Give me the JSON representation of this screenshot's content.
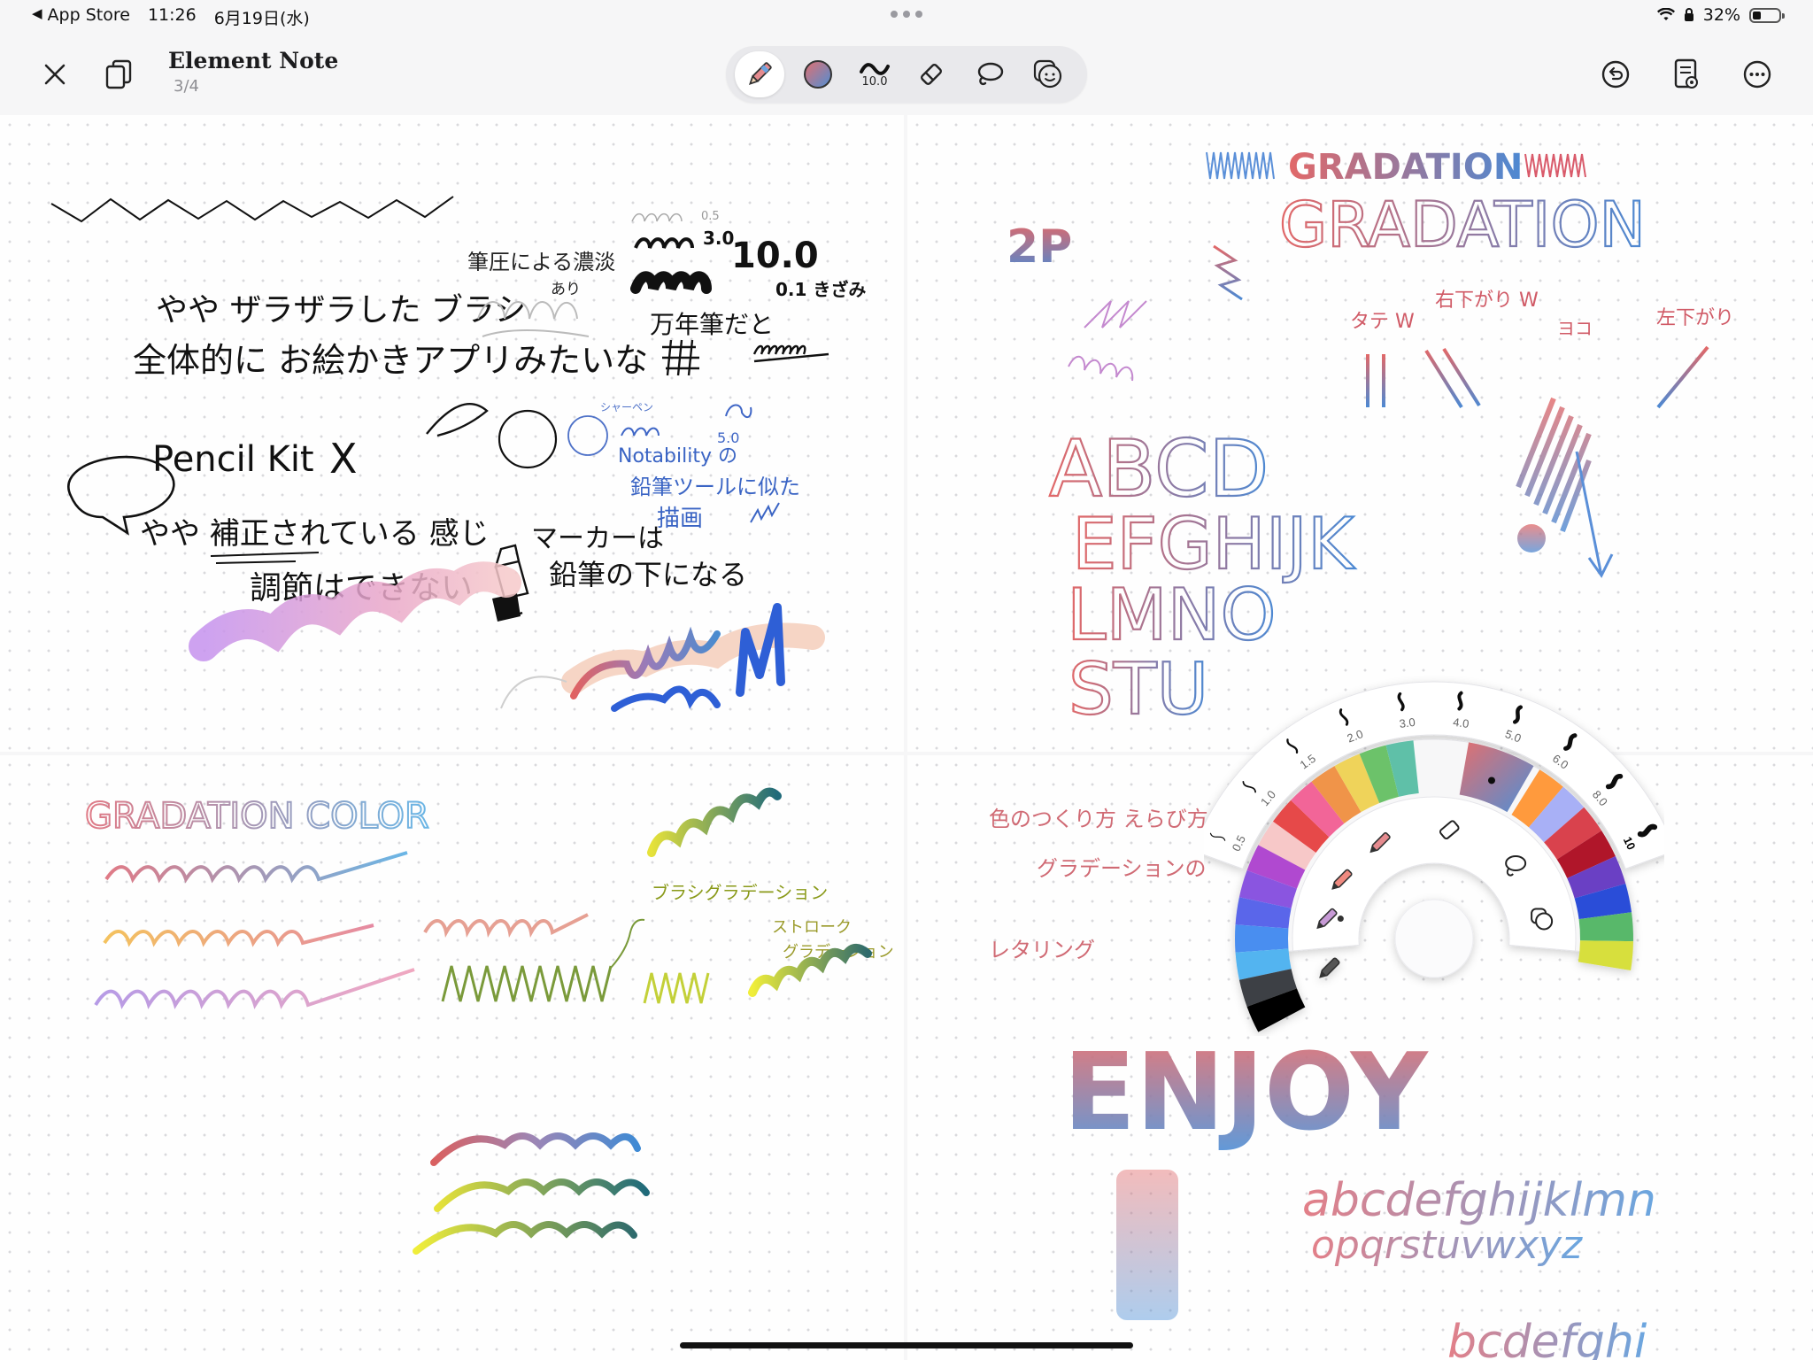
{
  "status_bar": {
    "back_app": "App Store",
    "time": "11:26",
    "date": "6月19日(水)",
    "battery": "32%",
    "battery_level": 0.32
  },
  "toolbar": {
    "title": "Element Note",
    "page": "3/4",
    "brush_size": "10.0",
    "icons": {
      "close": "close-icon",
      "pages": "pages-icon",
      "pencil": "pencil-icon",
      "color": "color-swatch-icon",
      "brush": "brush-size-icon",
      "eraser": "eraser-icon",
      "lasso": "lasso-icon",
      "sticker": "sticker-icon",
      "undo": "undo-icon",
      "notes": "notes-icon",
      "more": "more-icon"
    }
  },
  "colors": {
    "accent_pencil": "#e58b8f",
    "gradient_start": "#e36f6f",
    "gradient_end": "#4e8fd6"
  },
  "page1": {
    "line1": "やや ザラザラした ブラシ",
    "line2": "全体的に お絵かきアプリみたいな",
    "pressure": "筆圧による濃淡",
    "pressure_sub": "あり",
    "size_small": "0.5",
    "size_mid": "3.0",
    "size_big": "10.0",
    "step": "0.1 きざみ",
    "fountain": "万年筆だと",
    "pencilkit": "Pencil Kit",
    "x_mark": "X",
    "sharpen": "シャーペン",
    "size5": "5.0",
    "notability": "Notability の",
    "notability2": "鉛筆ツールに似た",
    "notability3": "描画",
    "correction": "やや 補正されている 感じ",
    "adjust": "調節はできない",
    "marker1": "マーカーは",
    "marker2": "鉛筆の下になる"
  },
  "page2": {
    "grad_small": "GRADATION",
    "grad_big": "GRADATION",
    "two_p": "2P",
    "tate": "タテ W",
    "migisagari": "右下がり W",
    "yoko": "ヨコ",
    "hidarisagari": "左下がり",
    "abcd": "ABCD",
    "efg": "EFGHIJK",
    "lmn": "LMNO",
    "stu": "STU"
  },
  "page3": {
    "title": "GRADATION COLOR",
    "brush_grad": "ブラシグラデーション",
    "stroke_grad1": "ストローク",
    "stroke_grad2": "グラデーション"
  },
  "page4": {
    "line1": "色のつくり方 えらび方",
    "line2": "グラデーションの",
    "lettering": "レタリング",
    "enjoy": "ENJOY",
    "alpha1": "abcdefghijklmn",
    "alpha2": "opqrstuvwxyz",
    "alpha3": "bcdefghi"
  },
  "radial_menu": {
    "sizes": [
      "0.5",
      "1.0",
      "1.5",
      "2.0",
      "3.0",
      "4.0",
      "5.0",
      "6.0",
      "8.0",
      "10"
    ],
    "selected_size": "10",
    "icons": [
      "marker-icon",
      "pencil-pink-icon",
      "eraser-icon",
      "pencil-gradient-icon",
      "lasso-icon",
      "pen-icon",
      "sticker-icon"
    ],
    "palette_left": [
      "#f7c8c8",
      "#e64a4a",
      "#f26598",
      "#f0944a",
      "#efd35a",
      "#6cc26a",
      "#5fc0a8"
    ],
    "palette_ring": [
      "#b04ad0",
      "#8a55e0",
      "#5a66ea",
      "#4a8ef0",
      "#52b4f0",
      "#3c3f44",
      "#000000"
    ],
    "palette_right": [
      "#ff9a3c",
      "#a8b0f6",
      "#d9434e",
      "#b0162a",
      "#6a3fc4",
      "#2c4ed8",
      "#58b86a",
      "#d7df3c"
    ]
  }
}
